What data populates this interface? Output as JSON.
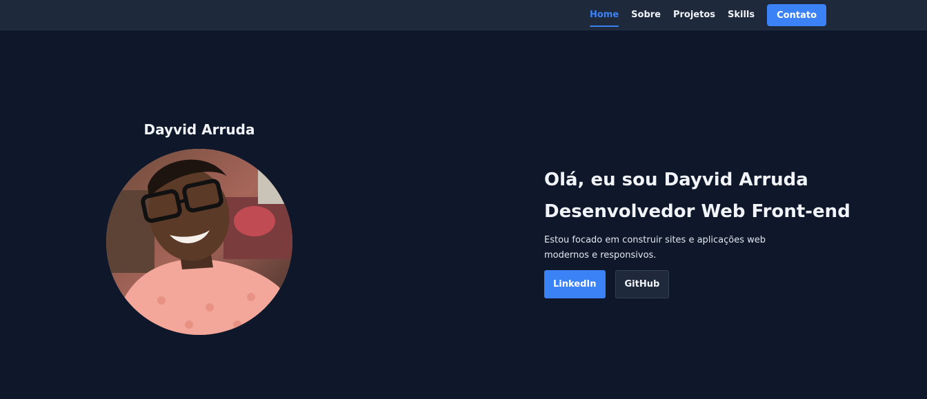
{
  "nav": {
    "links": [
      "Home",
      "Sobre",
      "Projetos",
      "Skills"
    ],
    "contact_label": "Contato"
  },
  "profile": {
    "name": "Dayvid Arruda"
  },
  "intro": {
    "greeting": "Olá, eu sou Dayvid Arruda",
    "role": "Desenvolvedor Web Front-end",
    "description": "Estou focado em construir sites e aplicações web modernos e responsivos.",
    "linkedin_label": "LinkedIn",
    "github_label": "GitHub"
  },
  "colors": {
    "background": "#0f172a",
    "navbar": "#1e293b",
    "accent": "#3b82f6",
    "text": "#f1f5f9"
  }
}
